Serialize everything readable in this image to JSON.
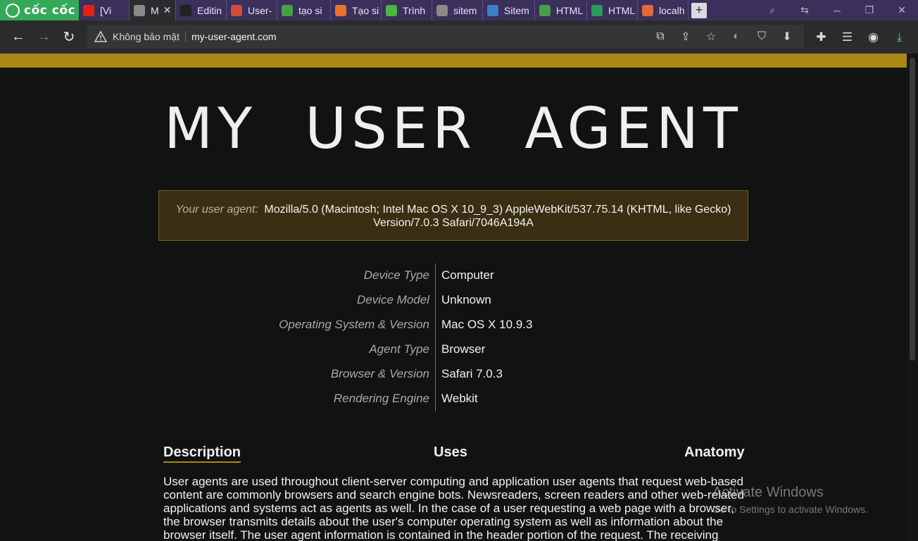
{
  "browser": {
    "brand": "cốc cốc",
    "tabs": [
      {
        "label": "[Vi",
        "icon": "youtube-icon",
        "color": "#e62117"
      },
      {
        "label": "M",
        "icon": "globe-icon",
        "color": "#8a8a8a",
        "active": true
      },
      {
        "label": "Editin",
        "icon": "github-icon",
        "color": "#222222"
      },
      {
        "label": "User-",
        "icon": "image-icon",
        "color": "#d14b3a"
      },
      {
        "label": "tạo si",
        "icon": "leaf-icon",
        "color": "#47a047"
      },
      {
        "label": "Tạo si",
        "icon": "circle-icon",
        "color": "#e8742c"
      },
      {
        "label": "Trình",
        "icon": "shield-icon",
        "color": "#4bb543"
      },
      {
        "label": "sitem",
        "icon": "globe-icon",
        "color": "#8a8a8a"
      },
      {
        "label": "Sitem",
        "icon": "g-icon",
        "color": "#3b82c4"
      },
      {
        "label": "HTML",
        "icon": "leaf-icon",
        "color": "#47a047"
      },
      {
        "label": "HTML",
        "icon": "leaf-icon",
        "color": "#2b9a5b"
      },
      {
        "label": "localh",
        "icon": "box-icon",
        "color": "#e06a3a"
      }
    ],
    "address": {
      "security_label": "Không bảo mật",
      "url": "my-user-agent.com"
    }
  },
  "page": {
    "title": "MY USER AGENT",
    "ua_label": "Your user agent:",
    "ua_value": "Mozilla/5.0 (Macintosh; Intel Mac OS X 10_9_3) AppleWebKit/537.75.14 (KHTML, like Gecko) Version/7.0.3 Safari/7046A194A",
    "properties": [
      {
        "label": "Device Type",
        "value": "Computer"
      },
      {
        "label": "Device Model",
        "value": "Unknown"
      },
      {
        "label": "Operating System & Version",
        "value": "Mac OS X 10.9.3"
      },
      {
        "label": "Agent Type",
        "value": "Browser"
      },
      {
        "label": "Browser & Version",
        "value": "Safari 7.0.3"
      },
      {
        "label": "Rendering Engine",
        "value": "Webkit"
      }
    ],
    "sections": [
      "Description",
      "Uses",
      "Anatomy"
    ],
    "description": "User agents are used throughout client-server computing and application user agents that request web-based content are commonly browsers and search engine bots. Newsreaders, screen readers and other web-related applications and systems act as agents as well. In the case of a user requesting a web page with a browser, the browser transmits details about the user's computer operating system as well as information about the browser itself. The user agent information is contained in the header portion of the request. The receiving server may"
  },
  "watermark": {
    "line1": "Activate Windows",
    "line2": "Go to Settings to activate Windows."
  },
  "colors": {
    "accent_gold": "#a88915",
    "ua_box_bg": "#3a2f12",
    "tabbar_bg": "#3b2f5c",
    "brand_green": "#35a95a"
  }
}
